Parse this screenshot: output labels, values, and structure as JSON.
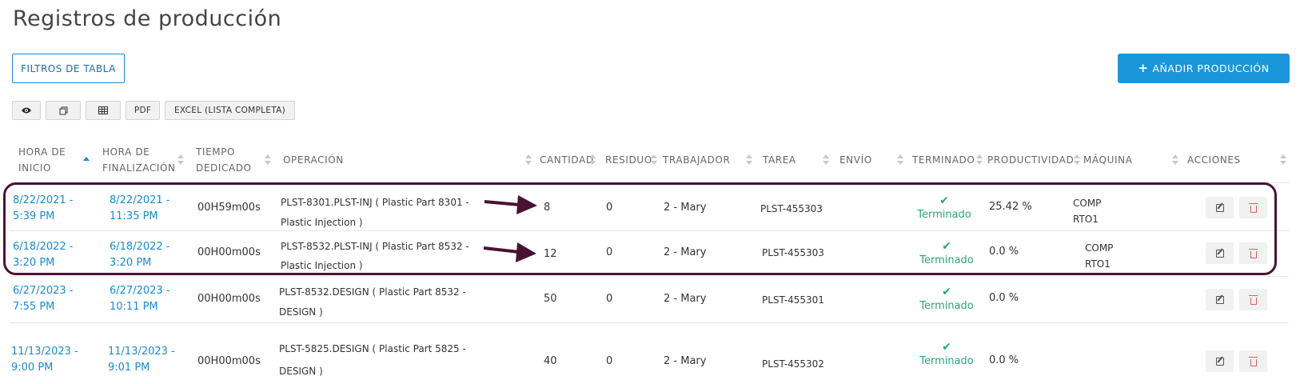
{
  "page": {
    "title": "Registros de producción"
  },
  "buttons": {
    "filters": "FILTROS DE TABLA",
    "add": "AÑADIR PRODUCCIÓN",
    "add_icon": "plus-icon"
  },
  "toolbar": {
    "view_icon": "eye-icon",
    "copy_icon": "copy-icon",
    "grid_icon": "table-icon",
    "pdf": "PDF",
    "excel": "EXCEL (LISTA COMPLETA)"
  },
  "columns": {
    "start": [
      "HORA DE",
      "INICIO"
    ],
    "end": [
      "HORA DE",
      "FINALIZACIÓN"
    ],
    "time": [
      "TIEMPO",
      "DEDICADO"
    ],
    "operation": "OPERACIÓN",
    "quantity": "CANTIDAD",
    "waste": "RESIDUO",
    "worker": "TRABAJADOR",
    "task": "TAREA",
    "shipment": "ENVÍO",
    "done": "TERMINADO",
    "productivity": "PRODUCTIVIDAD",
    "machine": "MÁQUINA",
    "actions": "ACCIONES"
  },
  "rows": [
    {
      "start": [
        "8/22/2021 -",
        "5:39 PM"
      ],
      "end": [
        "8/22/2021 -",
        "11:35 PM"
      ],
      "time": "00H59m00s",
      "operation": [
        "PLST-8301.PLST-INJ ( Plastic Part 8301 -",
        "Plastic Injection )"
      ],
      "quantity": "8",
      "waste": "0",
      "worker": "2 - Mary",
      "task": "PLST-455303",
      "done": "Terminado",
      "productivity": "25.42 %",
      "machine": [
        "COMP",
        "RTO1"
      ]
    },
    {
      "start": [
        "6/18/2022 -",
        "3:20 PM"
      ],
      "end": [
        "6/18/2022 -",
        "3:20 PM"
      ],
      "time": "00H00m00s",
      "operation": [
        "PLST-8532.PLST-INJ ( Plastic Part 8532 -",
        "Plastic Injection )"
      ],
      "quantity": "12",
      "waste": "0",
      "worker": "2 - Mary",
      "task": "PLST-455303",
      "done": "Terminado",
      "productivity": "0.0 %",
      "machine": [
        "COMP",
        "RTO1"
      ]
    },
    {
      "start": [
        "6/27/2023 -",
        "7:55 PM"
      ],
      "end": [
        "6/27/2023 -",
        "10:11 PM"
      ],
      "time": "00H00m00s",
      "operation": [
        "PLST-8532.DESIGN ( Plastic Part 8532 -",
        "DESIGN )"
      ],
      "quantity": "50",
      "waste": "0",
      "worker": "2 - Mary",
      "task": "PLST-455301",
      "done": "Terminado",
      "productivity": "0.0 %",
      "machine": [
        "",
        ""
      ]
    },
    {
      "start": [
        "11/13/2023 -",
        "9:00 PM"
      ],
      "end": [
        "11/13/2023 -",
        "9:01 PM"
      ],
      "time": "00H00m00s",
      "operation": [
        "PLST-5825.DESIGN ( Plastic Part 5825 -",
        "DESIGN )"
      ],
      "quantity": "40",
      "waste": "0",
      "worker": "2 - Mary",
      "task": "PLST-455302",
      "done": "Terminado",
      "productivity": "0.0 %",
      "machine": [
        "",
        ""
      ]
    }
  ],
  "colors": {
    "accent": "#1a96db",
    "link": "#1a8bd0",
    "done": "#2aa57a",
    "highlight": "#4a1232",
    "delete": "#e05a5a"
  }
}
